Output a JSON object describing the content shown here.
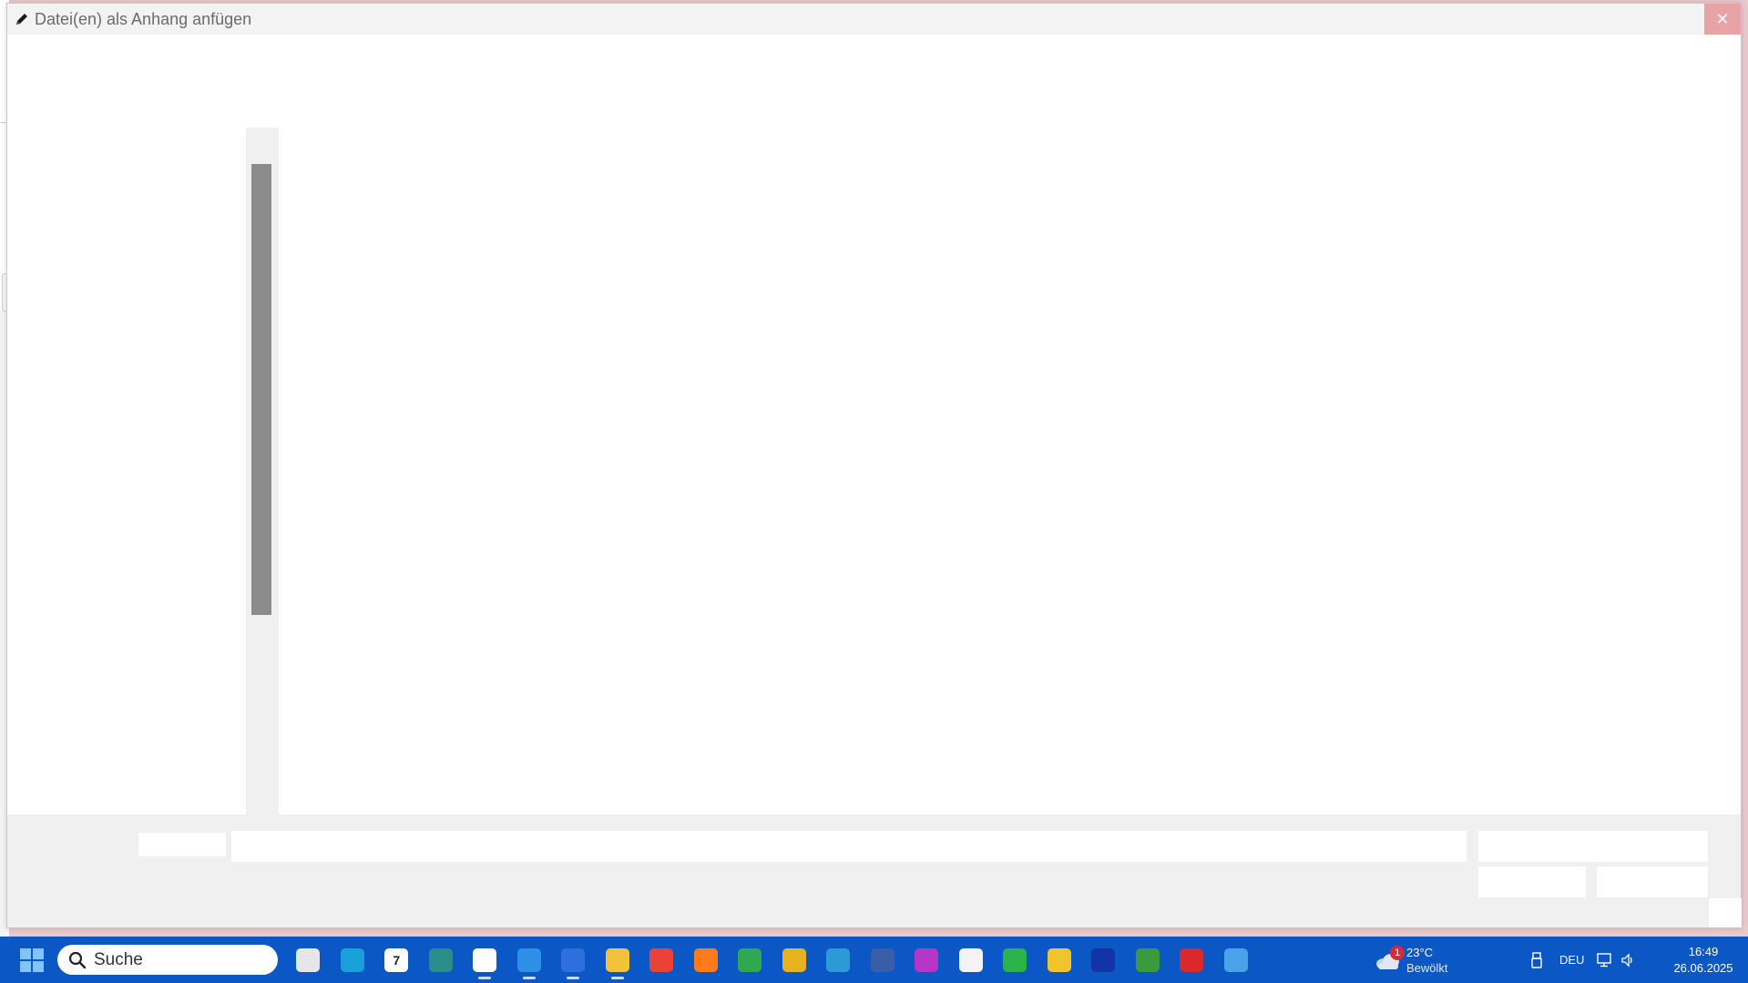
{
  "dialog": {
    "title": "Datei(en) als Anhang anfügen",
    "close_symbol": "✕"
  },
  "taskbar": {
    "search_label": "Suche",
    "apps": [
      {
        "name": "task-view-icon",
        "color": "#e6e6e6",
        "glyph": ""
      },
      {
        "name": "remote-desktop-icon",
        "color": "#1aa0d8",
        "glyph": ""
      },
      {
        "name": "calendar-icon",
        "color": "#ffffff",
        "glyph": "7"
      },
      {
        "name": "support-app-icon",
        "color": "#2a8d8a",
        "glyph": ""
      },
      {
        "name": "snipping-tool-icon",
        "color": "#ffffff",
        "glyph": ""
      },
      {
        "name": "notepad-icon",
        "color": "#2d8fe6",
        "glyph": ""
      },
      {
        "name": "thunderbird-icon",
        "color": "#2f6fdc",
        "glyph": ""
      },
      {
        "name": "file-explorer-icon",
        "color": "#f2c23a",
        "glyph": ""
      },
      {
        "name": "chrome-icon",
        "color": "#ea4335",
        "glyph": ""
      },
      {
        "name": "firefox-icon",
        "color": "#ff7a1a",
        "glyph": ""
      },
      {
        "name": "green-app-icon",
        "color": "#2fa84f",
        "glyph": ""
      },
      {
        "name": "multicolor-app-icon",
        "color": "#e8b21f",
        "glyph": ""
      },
      {
        "name": "globe-app-icon",
        "color": "#2d9ad8",
        "glyph": ""
      },
      {
        "name": "document-app-icon",
        "color": "#3a5da8",
        "glyph": ""
      },
      {
        "name": "affinity-icon",
        "color": "#b634c6",
        "glyph": ""
      },
      {
        "name": "mouse-app-icon",
        "color": "#f3f3f3",
        "glyph": ""
      },
      {
        "name": "pen-app-icon",
        "color": "#2bb24a",
        "glyph": ""
      },
      {
        "name": "clock-app-icon",
        "color": "#f2c42c",
        "glyph": ""
      },
      {
        "name": "cloud-app-icon",
        "color": "#1533a8",
        "glyph": ""
      },
      {
        "name": "sheet-app-icon",
        "color": "#3b9a3e",
        "glyph": ""
      },
      {
        "name": "lips-app-icon",
        "color": "#d82a2a",
        "glyph": ""
      },
      {
        "name": "window-app-icon",
        "color": "#4aa3e8",
        "glyph": ""
      }
    ],
    "weather": {
      "badge": "1",
      "temperature": "23°C",
      "condition": "Bewölkt"
    },
    "tray": {
      "language": "DEU"
    },
    "clock": {
      "time": "16:49",
      "date": "26.06.2025"
    }
  }
}
